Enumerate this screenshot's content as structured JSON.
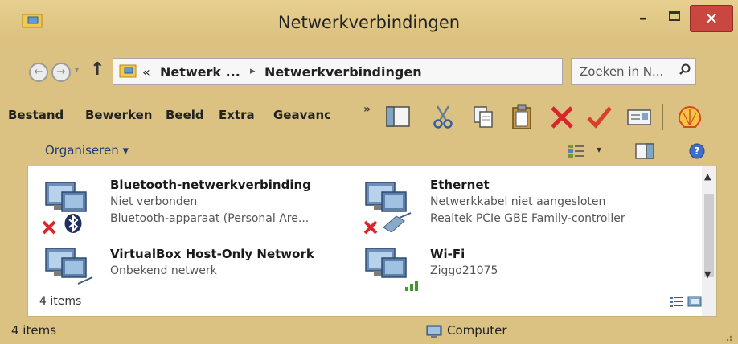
{
  "window": {
    "title": "Netwerkverbindingen",
    "minimize": "–",
    "close": "✕"
  },
  "address": {
    "prefix": "«",
    "crumb_parent": "Netwerk ...",
    "crumb_sep": "▸",
    "crumb_current": "Netwerkverbindingen",
    "dropdown": "⌄",
    "refresh": "↻"
  },
  "search": {
    "placeholder": "Zoeken in N..."
  },
  "nav": {
    "back": "←",
    "forward": "→",
    "dropdown": "▾",
    "up": "↑"
  },
  "menu": {
    "items": [
      "Bestand",
      "Bewerken",
      "Beeld",
      "Extra",
      "Geavanc"
    ],
    "more": "»"
  },
  "command": {
    "organize": "Organiseren ▾",
    "view_dd": "▾"
  },
  "connections": [
    {
      "name": "Bluetooth-netwerkverbinding",
      "status": "Niet verbonden",
      "device": "Bluetooth-apparaat (Personal Are..."
    },
    {
      "name": "Ethernet",
      "status": "Netwerkkabel niet aangesloten",
      "device": "Realtek PCIe GBE Family-controller"
    },
    {
      "name": "VirtualBox Host-Only Network",
      "status": "Onbekend netwerk"
    },
    {
      "name": "Wi-Fi",
      "status": "Ziggo21075"
    }
  ],
  "content_count": "4 items",
  "status": {
    "count": "4 items",
    "location": "Computer"
  },
  "colors": {
    "frame": "#dcc282",
    "close": "#c9473f",
    "link": "#1f3a6e",
    "error": "#d8262b"
  }
}
